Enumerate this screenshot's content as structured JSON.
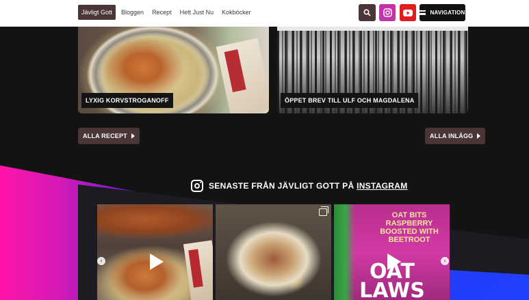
{
  "header": {
    "nav": [
      {
        "label": "Jävligt Gott",
        "active": true
      },
      {
        "label": "Bloggen"
      },
      {
        "label": "Recept"
      },
      {
        "label": "Hett Just Nu"
      },
      {
        "label": "Kokböcker"
      }
    ],
    "navigation_label": "NAVIGATION",
    "icons": [
      "search-icon",
      "instagram-icon",
      "youtube-icon",
      "menu-icon"
    ]
  },
  "cards": [
    {
      "caption": "LYXIG KORVSTROGANOFF"
    },
    {
      "caption": "ÖPPET BREV TILL ULF OCH MAGDALENA"
    }
  ],
  "buttons": {
    "all_recipes": "ALLA RECEPT",
    "all_posts": "ALLA INLÄGG"
  },
  "instagram": {
    "heading_prefix": "SENASTE FRÅN JÄVLIGT GOTT PÅ",
    "heading_link": "INSTAGRAM",
    "tile3_small": "OAT BITS RASPBERRY BOOSTED WITH BEETROOT",
    "tile3_word": "OAT LAWS"
  },
  "colors": {
    "accent": "#4a3537",
    "instagram": "#c8349f",
    "youtube": "#e21d1d",
    "pink": "#ff14a8",
    "blue": "#2040ff"
  }
}
